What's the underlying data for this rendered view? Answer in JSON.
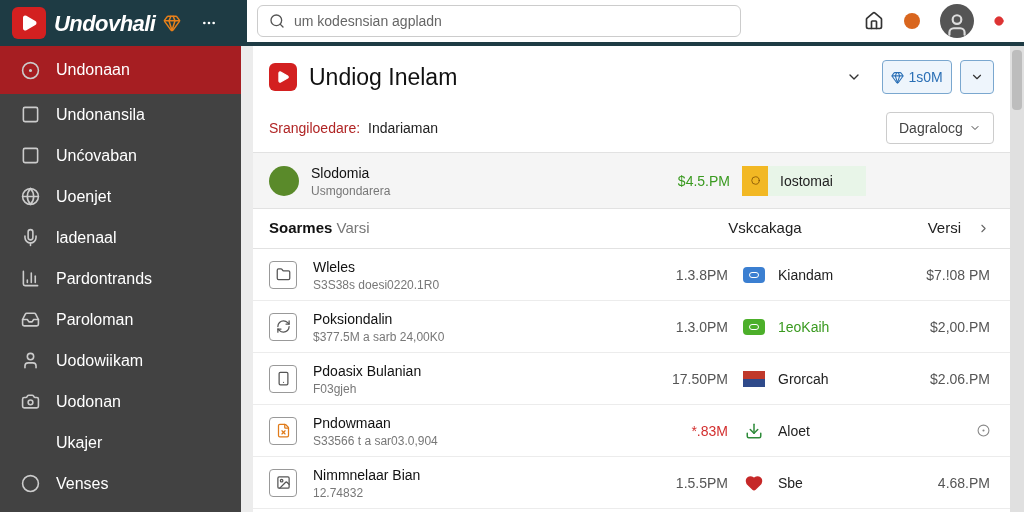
{
  "app_bar": {
    "brand": "Undovhali",
    "search": {
      "placeholder": "um kodesnsian agpladn"
    }
  },
  "sidebar": {
    "items": [
      {
        "label": "Undonaan",
        "selected": true
      },
      {
        "label": "Undonansila",
        "selected": false
      },
      {
        "label": "Unćovaban",
        "selected": false
      },
      {
        "label": "Uoenjet",
        "selected": false
      },
      {
        "label": "ladenaal",
        "selected": false
      },
      {
        "label": "Pardontrands",
        "selected": false
      },
      {
        "label": "Paroloman",
        "selected": false
      },
      {
        "label": "Uodowiikam",
        "selected": false
      },
      {
        "label": "Uodonan",
        "selected": false
      },
      {
        "label": "Ukajer",
        "selected": false
      },
      {
        "label": "Venses",
        "selected": false
      }
    ]
  },
  "panel": {
    "title": "Undiog Inelam",
    "action_button": "1s0M",
    "subtitle": {
      "label": "Srangiloedare:",
      "value": "Indariaman"
    },
    "sort_select": "Dagralocg",
    "featured": {
      "name": "Slodomia",
      "detail": "Usmgondarera",
      "time": "$4.5.PM",
      "tag": "Iostomai"
    },
    "columns": [
      {
        "label": "Soarmes",
        "sub": "Varsi"
      },
      {
        "label": "Vskcakaga"
      },
      {
        "label": "Versi"
      }
    ],
    "rows": [
      {
        "name": "Wleles",
        "detail": "S3S38s doesi0220.1R0",
        "time": "1.3.8PM",
        "alert": false,
        "tag": {
          "kind": "square",
          "label": "Kiandam",
          "color": "#3b7fd1",
          "highlight": false
        },
        "value": "$7.!08 PM"
      },
      {
        "name": "Poksiondalin",
        "detail": "$377.5M a sarb 24,00K0",
        "time": "1.3.0PM",
        "alert": false,
        "tag": {
          "kind": "square",
          "label": "1eoKaih",
          "color": "#4caf2a",
          "highlight": true
        },
        "value": "$2,00.PM"
      },
      {
        "name": "Pdoasix Bulanian",
        "detail": "F03gjeh",
        "time": "17.50PM",
        "alert": false,
        "tag": {
          "kind": "flag",
          "label": "Grorcah",
          "color": "#2f4a8a",
          "highlight": false
        },
        "value": "$2.06.PM"
      },
      {
        "name": "Pndowmaan",
        "detail": "S33566 t a sar03.0,904",
        "time": "*.83M",
        "alert": true,
        "tag": {
          "kind": "download",
          "label": "Aloet",
          "color": "#2e8b3a",
          "highlight": false
        }
      },
      {
        "name": "Nimmnelaar Bian",
        "detail": "12.74832",
        "time": "1.5.5PM",
        "alert": false,
        "tag": {
          "kind": "heart",
          "label": "Sbe",
          "color": "#c62828",
          "highlight": false
        },
        "value": "4.68.PM"
      }
    ]
  }
}
